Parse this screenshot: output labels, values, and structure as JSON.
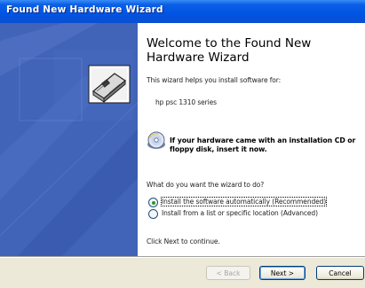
{
  "window": {
    "title": "Found New Hardware Wizard"
  },
  "welcome": {
    "heading": "Welcome to the Found New Hardware Wizard",
    "intro": "This wizard helps you install software for:",
    "device": "hp psc 1310 series",
    "cd_instruction": "If your hardware came with an installation CD or floppy disk, insert it now."
  },
  "question": "What do you want the wizard to do?",
  "options": [
    {
      "label": "Install the software automatically (Recommended)",
      "selected": true
    },
    {
      "label": "Install from a list or specific location (Advanced)",
      "selected": false
    }
  ],
  "continue_hint": "Click Next to continue.",
  "buttons": {
    "back": "< Back",
    "next": "Next >",
    "cancel": "Cancel"
  },
  "icons": {
    "hardware": "hardware-card-icon",
    "cd": "cd-disk-icon"
  },
  "colors": {
    "titlebar": "#0054e3",
    "banner": "#4163b8",
    "footer": "#ece9d8"
  }
}
